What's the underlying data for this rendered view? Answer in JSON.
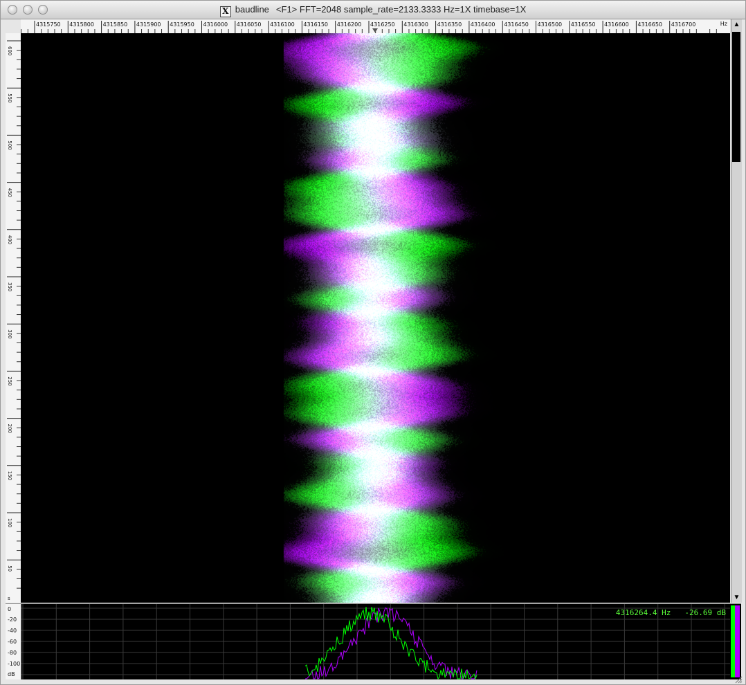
{
  "window": {
    "app_name": "baudline",
    "title": "<F1> FFT=2048 sample_rate=2133.3333 Hz=1X timebase=1X",
    "icon": "x11-icon"
  },
  "freq_axis": {
    "unit": "Hz",
    "ticks": [
      "4315750",
      "4315800",
      "4315850",
      "4315900",
      "4315950",
      "4316000",
      "4316050",
      "4316100",
      "4316150",
      "4316200",
      "4316250",
      "4316300",
      "4316350",
      "4316400",
      "4316450",
      "4316500",
      "4316550",
      "4316600",
      "4316650",
      "4316700"
    ],
    "marker_icon": "triangle-down-icon"
  },
  "time_axis": {
    "unit": "s",
    "ticks": [
      "600",
      "550",
      "500",
      "450",
      "400",
      "350",
      "300",
      "250",
      "200",
      "150",
      "100",
      "50"
    ]
  },
  "spectrum": {
    "readout_freq": "4316264.4 Hz",
    "readout_db": "-26.69 dB",
    "db_ticks": [
      "0",
      "-20",
      "-40",
      "-60",
      "-80",
      "-100"
    ],
    "db_unit": "dB"
  },
  "colors": {
    "channel_a": "#00ff00",
    "channel_b": "#b000ff",
    "background": "#000000",
    "readout": "#5bff3a",
    "grid": "#3a3a3a"
  },
  "scrollbar": {
    "up_icon": "arrow-up-icon",
    "down_icon": "arrow-down-icon"
  }
}
